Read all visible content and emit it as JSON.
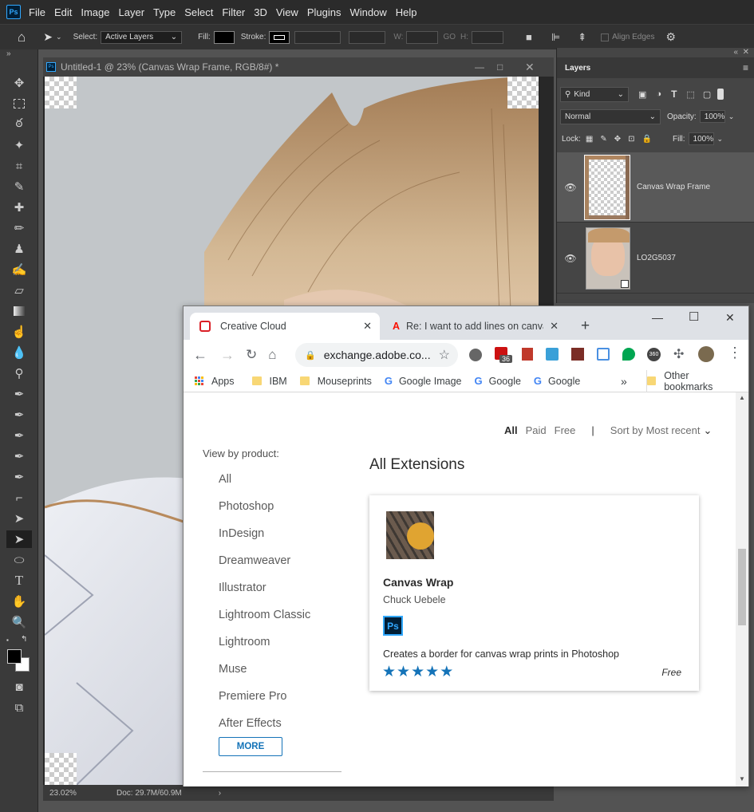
{
  "menubar": {
    "logo": "Ps",
    "items": [
      "File",
      "Edit",
      "Image",
      "Layer",
      "Type",
      "Select",
      "Filter",
      "3D",
      "View",
      "Plugins",
      "Window",
      "Help"
    ]
  },
  "options": {
    "select_label": "Select:",
    "select_value": "Active Layers",
    "fill_label": "Fill:",
    "stroke_label": "Stroke:",
    "w_label": "W:",
    "go_label": "GO",
    "h_label": "H:",
    "align_edges": "Align Edges"
  },
  "document": {
    "title": "Untitled-1 @ 23% (Canvas Wrap Frame, RGB/8#) *",
    "zoom": "23.02%",
    "doc_info": "Doc: 29.7M/60.9M"
  },
  "layers_panel": {
    "title": "Layers",
    "kind": "Kind",
    "blend_mode": "Normal",
    "opacity_label": "Opacity:",
    "opacity_value": "100%",
    "lock_label": "Lock:",
    "fill_label": "Fill:",
    "fill_value": "100%",
    "layers": [
      {
        "name": "Canvas Wrap Frame"
      },
      {
        "name": "LO2G5037"
      }
    ]
  },
  "browser": {
    "tabs": [
      {
        "title": "Creative Cloud"
      },
      {
        "title": "Re: I want to add lines on canvas"
      }
    ],
    "url": "exchange.adobe.co...",
    "ext_badge": "36",
    "bookmarks": [
      {
        "label": "Apps",
        "icon": "apps-icon"
      },
      {
        "label": "IBM",
        "icon": "folder-icon"
      },
      {
        "label": "Mouseprints",
        "icon": "folder-icon"
      },
      {
        "label": "Google Image",
        "icon": "google-icon"
      },
      {
        "label": "Google",
        "icon": "google-icon"
      },
      {
        "label": "Google",
        "icon": "google-icon"
      }
    ],
    "bookmarks_more": "»",
    "other_bookmarks": "Other bookmarks"
  },
  "exchange": {
    "filters": [
      "All",
      "Paid",
      "Free"
    ],
    "sort": "Sort by Most recent",
    "view_by": "View by product:",
    "products": [
      "All",
      "Photoshop",
      "InDesign",
      "Dreamweaver",
      "Illustrator",
      "Lightroom Classic",
      "Lightroom",
      "Muse",
      "Premiere Pro",
      "After Effects"
    ],
    "more_button": "MORE",
    "heading": "All Extensions",
    "card": {
      "title": "Canvas Wrap",
      "author": "Chuck Uebele",
      "app_badge": "Ps",
      "description": "Creates a border for canvas wrap prints in Photoshop",
      "rating": 5,
      "price": "Free"
    }
  },
  "colors": {
    "ps_blue": "#31a8ff",
    "chrome_tab_bg": "#dee1e6",
    "adobe_blue": "#1473b8"
  }
}
